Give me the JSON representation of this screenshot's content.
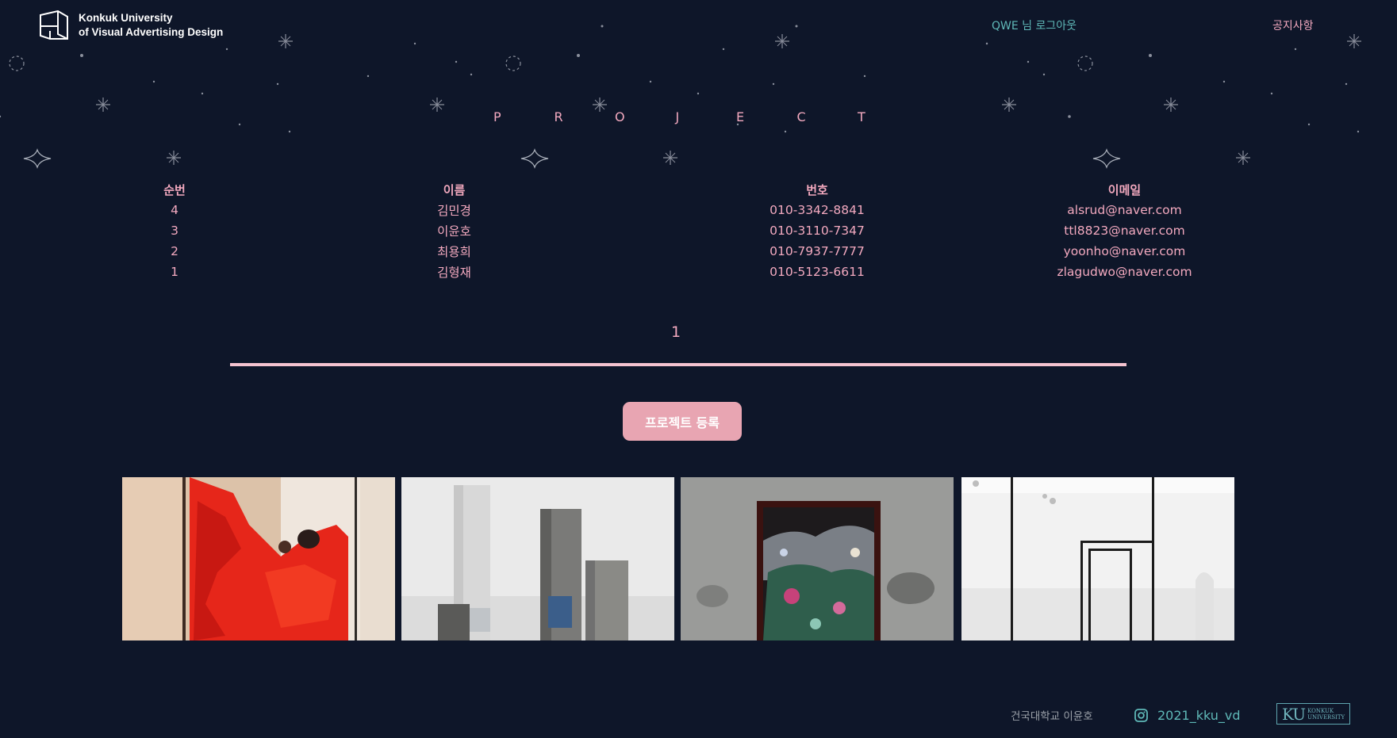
{
  "header": {
    "logo": {
      "line1": "Konkuk University",
      "line2": "of Visual Advertising Design"
    },
    "user_link": "QWE 님 로그아웃",
    "notice_link": "공지사항"
  },
  "page": {
    "title_letters": [
      "P",
      "R",
      "O",
      "J",
      "E",
      "C",
      "T"
    ]
  },
  "table": {
    "headers": [
      "순번",
      "이름",
      "번호",
      "이메일"
    ],
    "rows": [
      {
        "no": "4",
        "name": "김민경",
        "phone": "010-3342-8841",
        "email": "alsrud@naver.com"
      },
      {
        "no": "3",
        "name": "이윤호",
        "phone": "010-3110-7347",
        "email": "ttl8823@naver.com"
      },
      {
        "no": "2",
        "name": "최용희",
        "phone": "010-7937-7777",
        "email": "yoonho@naver.com"
      },
      {
        "no": "1",
        "name": "김형재",
        "phone": "010-5123-6611",
        "email": "zlagudwo@naver.com"
      }
    ]
  },
  "pagination": {
    "current_page": "1"
  },
  "actions": {
    "register_label": "프로젝트 등록"
  },
  "gallery": {
    "items": [
      "red-rope-sculpture",
      "concrete-pillars",
      "lacquer-mother-of-pearl-panel",
      "white-gallery-steel-frame"
    ]
  },
  "footer": {
    "credit": "건국대학교 이윤호",
    "instagram_handle": "2021_kku_vd",
    "instagram_icon": "instagram-icon",
    "ku_logo_mark": "KU",
    "ku_logo_line1": "KONKUK",
    "ku_logo_line2": "UNIVERSITY"
  },
  "colors": {
    "background": "#0e1629",
    "accent_pink": "#f3a9bf",
    "accent_teal": "#5fb9b8",
    "button": "#e8a5b2"
  }
}
